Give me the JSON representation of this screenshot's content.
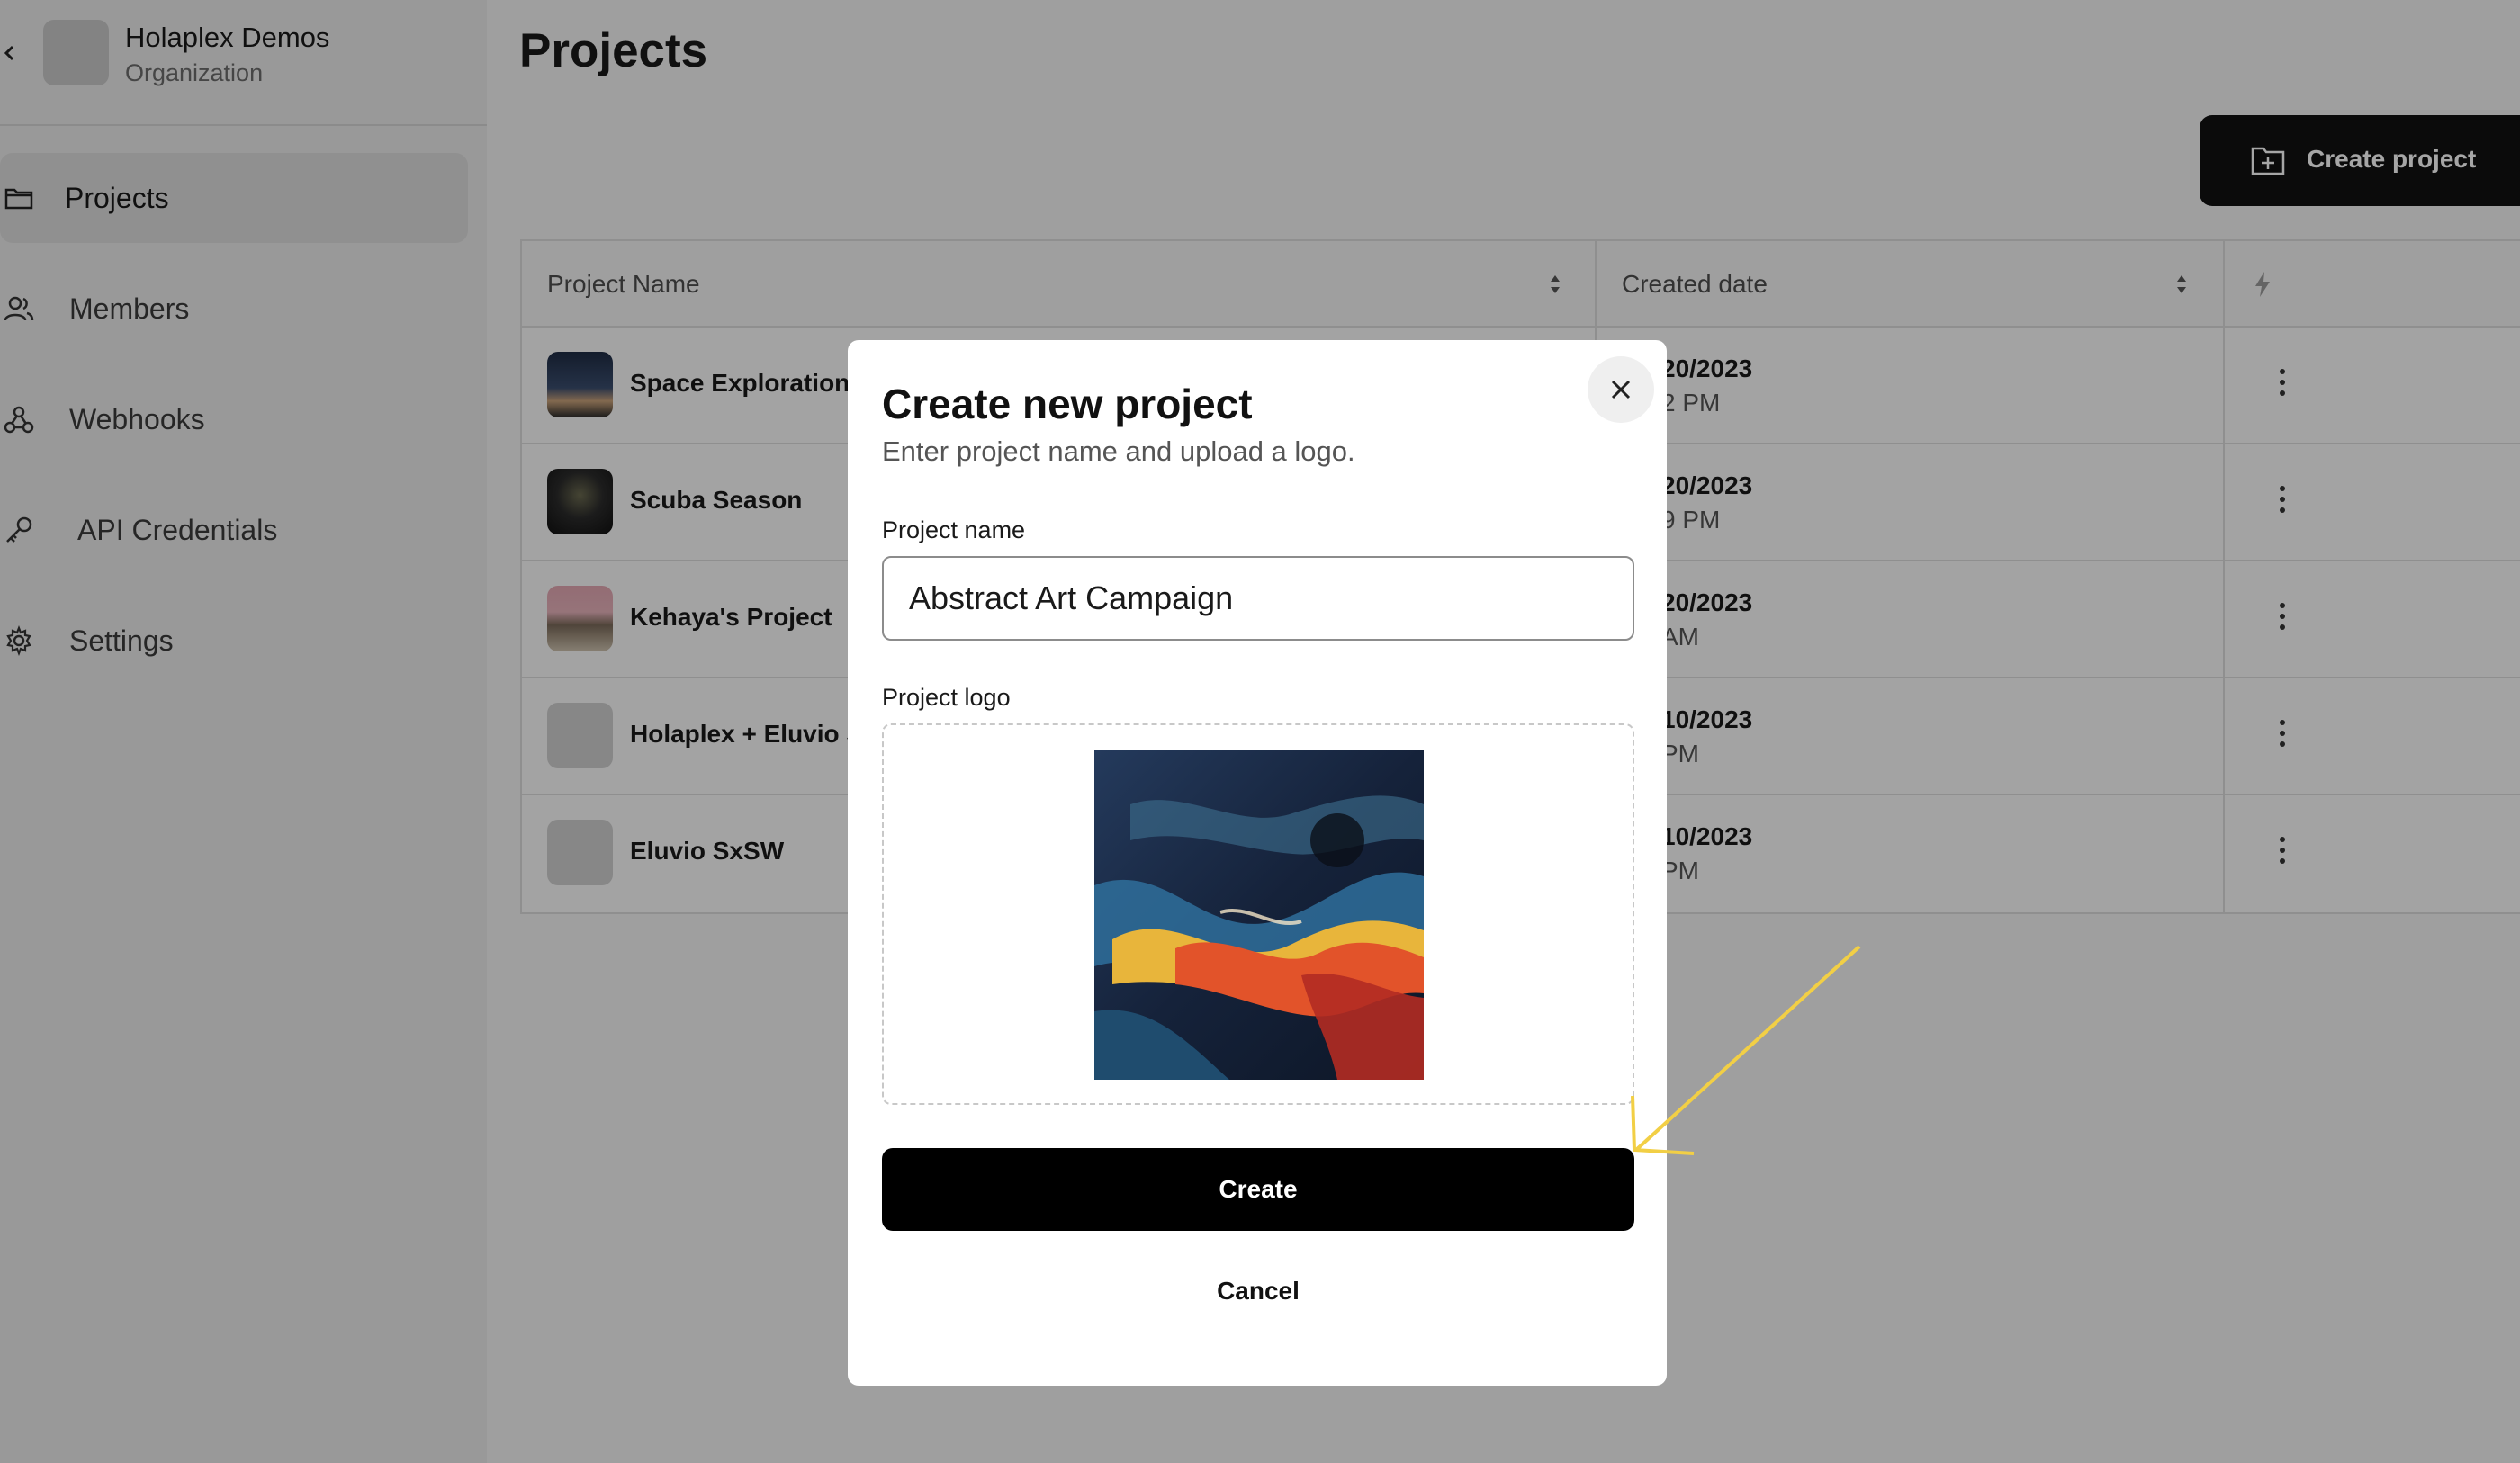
{
  "sidebar": {
    "org_name": "Holaplex Demos",
    "org_sub": "Organization",
    "items": [
      {
        "label": "Projects",
        "icon": "folder-icon"
      },
      {
        "label": "Members",
        "icon": "users-icon"
      },
      {
        "label": "Webhooks",
        "icon": "webhook-icon"
      },
      {
        "label": "API Credentials",
        "icon": "key-icon"
      },
      {
        "label": "Settings",
        "icon": "gear-icon"
      }
    ]
  },
  "main": {
    "title": "Projects",
    "create_button": "Create project",
    "table": {
      "headers": {
        "name": "Project Name",
        "date": "Created date"
      },
      "rows": [
        {
          "name": "Space Exploration",
          "date": "20/2023",
          "time": "2 PM"
        },
        {
          "name": "Scuba Season",
          "date": "20/2023",
          "time": "9 PM"
        },
        {
          "name": "Kehaya's Project",
          "date": "20/2023",
          "time": "AM"
        },
        {
          "name": "Holaplex + Eluvio S",
          "date": "10/2023",
          "time": "PM"
        },
        {
          "name": "Eluvio SxSW",
          "date": "10/2023",
          "time": "PM"
        }
      ]
    }
  },
  "modal": {
    "title": "Create new project",
    "subtitle": "Enter project name and upload a logo.",
    "name_label": "Project name",
    "name_value": "Abstract Art Campaign",
    "logo_label": "Project logo",
    "create": "Create",
    "cancel": "Cancel"
  },
  "colors": {
    "accent": "#000000",
    "annotation_arrow": "#f2cf45"
  }
}
